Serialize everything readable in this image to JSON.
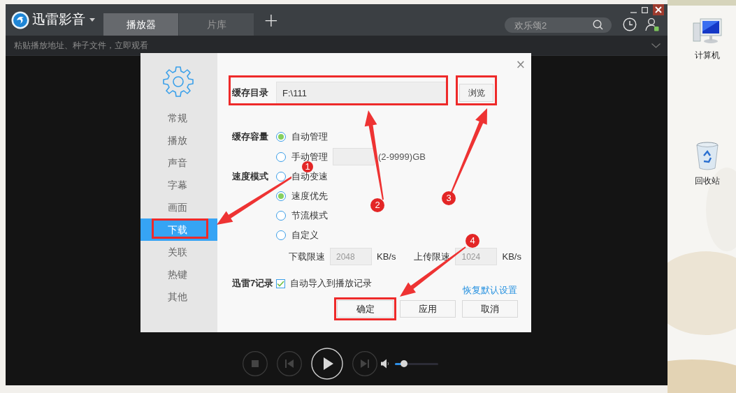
{
  "app": {
    "title": "迅雷影音",
    "tabs": [
      {
        "label": "播放器",
        "selected": true
      },
      {
        "label": "片库",
        "selected": false
      }
    ],
    "new_tab": "+",
    "search": {
      "placeholder": "欢乐颂2"
    },
    "address_bar": {
      "placeholder": "粘贴播放地址、种子文件，立即观看"
    }
  },
  "settings_dialog": {
    "close": "×",
    "nav": [
      {
        "label": "常规",
        "selected": false
      },
      {
        "label": "播放",
        "selected": false
      },
      {
        "label": "声音",
        "selected": false
      },
      {
        "label": "字幕",
        "selected": false
      },
      {
        "label": "画面",
        "selected": false
      },
      {
        "label": "下载",
        "selected": true
      },
      {
        "label": "关联",
        "selected": false
      },
      {
        "label": "热键",
        "selected": false
      },
      {
        "label": "其他",
        "selected": false
      }
    ],
    "cache_dir": {
      "label": "缓存目录",
      "value": "F:\\111",
      "browse": "浏览"
    },
    "cache_size": {
      "label": "缓存容量",
      "options": [
        {
          "label": "自动管理",
          "selected": true
        },
        {
          "label": "手动管理",
          "selected": false
        }
      ],
      "unit": "(2-9999)GB"
    },
    "speed_mode": {
      "label": "速度模式",
      "options": [
        {
          "label": "自动变速",
          "selected": false
        },
        {
          "label": "速度优先",
          "selected": true
        },
        {
          "label": "节流模式",
          "selected": false
        },
        {
          "label": "自定义",
          "selected": false
        }
      ]
    },
    "limits": [
      {
        "label": "下载限速",
        "value": "2048",
        "unit": "KB/s",
        "disabled": true
      },
      {
        "label": "上传限速",
        "value": "1024",
        "unit": "KB/s",
        "disabled": true
      }
    ],
    "record": {
      "label": "迅雷7记录",
      "checkbox": {
        "label": "自动导入到播放记录",
        "checked": true
      }
    },
    "restore_link": "恢复默认设置",
    "buttons": [
      "确定",
      "应用",
      "取消"
    ]
  },
  "player_controls": {
    "volume": {
      "level": 0.15
    }
  },
  "desktop_icons": [
    {
      "kind": "computer",
      "label": "计算机"
    },
    {
      "kind": "recycle_bin",
      "label": "回收站"
    }
  ],
  "annotations": [
    {
      "number": "1"
    },
    {
      "number": "2"
    },
    {
      "number": "3"
    },
    {
      "number": "4"
    }
  ]
}
